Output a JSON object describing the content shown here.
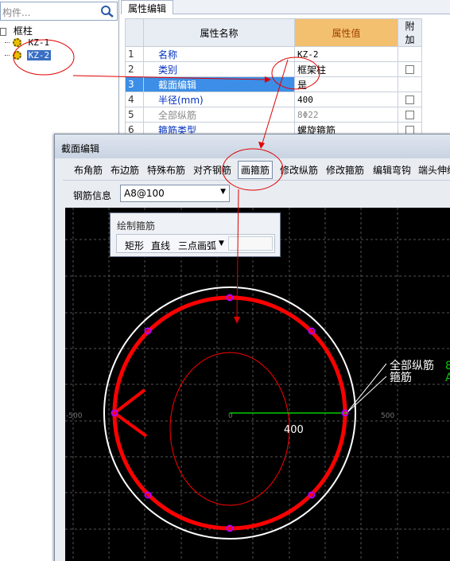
{
  "tree": {
    "search_placeholder": "构件...",
    "root_label": "框柱",
    "items": [
      {
        "label": "KZ-1"
      },
      {
        "label": "KZ-2"
      }
    ]
  },
  "props": {
    "tab_label": "属性编辑",
    "headers": {
      "name": "属性名称",
      "value": "属性值",
      "extra": "附加"
    },
    "rows": [
      {
        "idx": "1",
        "name": "名称",
        "value": "KZ-2"
      },
      {
        "idx": "2",
        "name": "类别",
        "value": "框架柱"
      },
      {
        "idx": "3",
        "name": "截面编辑",
        "value": "是"
      },
      {
        "idx": "4",
        "name": "半径(mm)",
        "value": "400"
      },
      {
        "idx": "5",
        "name": "全部纵筋",
        "value": "8Φ22"
      },
      {
        "idx": "6",
        "name": "箍筋类型",
        "value": "螺旋箍筋"
      }
    ]
  },
  "section_editor": {
    "title": "截面编辑",
    "toolbar": [
      "布角筋",
      "布边筋",
      "特殊布筋",
      "对齐钢筋",
      "画箍筋",
      "修改纵筋",
      "修改箍筋",
      "编辑弯钩",
      "端头伸缩"
    ],
    "rebar_info_label": "钢筋信息",
    "rebar_info_value": "A8@100",
    "draw_toolbar": {
      "title": "绘制箍筋",
      "buttons": [
        "矩形",
        "直线",
        "三点画弧"
      ]
    },
    "canvas": {
      "dim_value": "400",
      "axis_left": "-500",
      "axis_right": "500",
      "axis_origin": "0",
      "label_longitudinal": "全部纵筋",
      "label_stirrup": "箍筋",
      "label_long_suffix": "8",
      "label_stirrup_suffix": "A"
    }
  },
  "colors": {
    "accent_selected": "#3c8ee6",
    "stirrup_red": "#ff0000",
    "value_header_orange": "#f3c070",
    "canvas_bg": "#000000",
    "rebar_point_purple": "#b000ff",
    "dim_green": "#00cc00"
  }
}
